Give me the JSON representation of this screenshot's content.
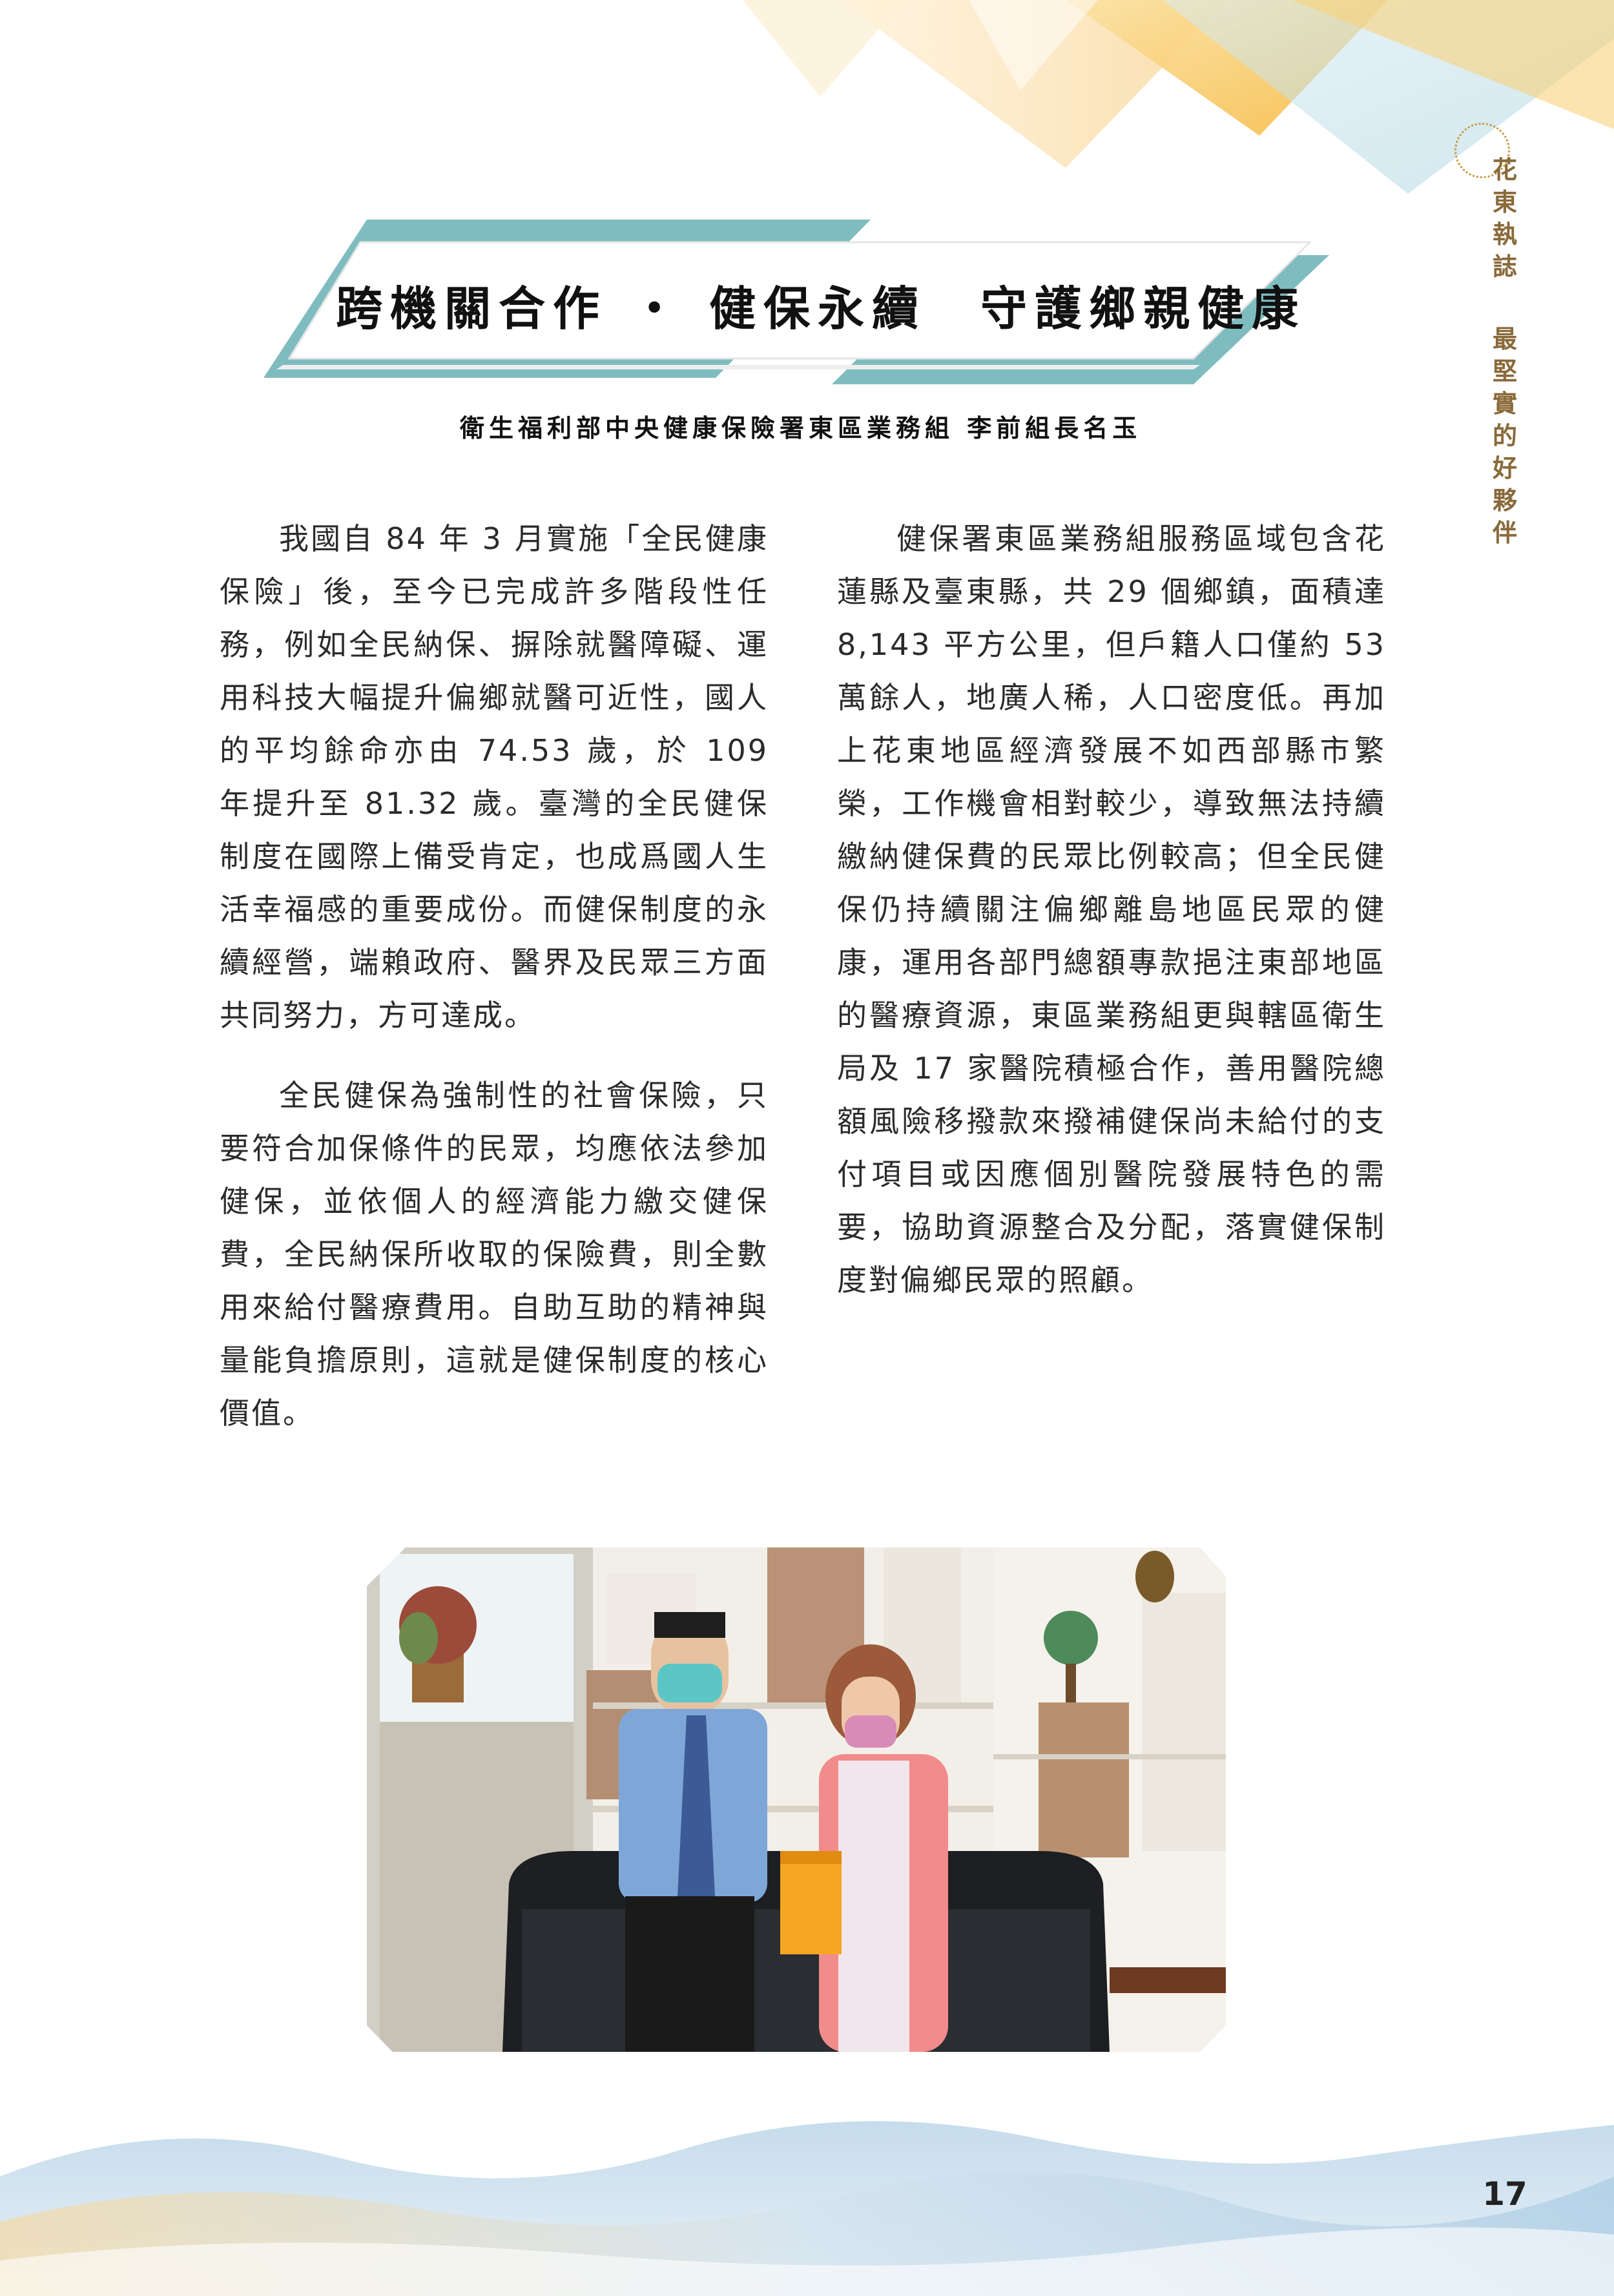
{
  "side_tag": {
    "part_a": [
      "花",
      "東",
      "執",
      "誌"
    ],
    "part_b": [
      "最",
      "堅",
      "實",
      "的",
      "好",
      "夥",
      "伴"
    ]
  },
  "title": "跨機關合作 ‧ 健保永續　守護鄉親健康",
  "byline": "衛生福利部中央健康保險署東區業務組 李前組長名玉",
  "left_column": [
    "我國自 84 年 3 月實施「全民健康保險」後，至今已完成許多階段性任務，例如全民納保、摒除就醫障礙、運用科技大幅提升偏鄉就醫可近性，國人的平均餘命亦由 74.53 歲，於 109 年提升至 81.32 歲。臺灣的全民健保制度在國際上備受肯定，也成爲國人生活幸福感的重要成份。而健保制度的永續經營，端賴政府、醫界及民眾三方面共同努力，方可達成。",
    "全民健保為強制性的社會保險，只要符合加保條件的民眾，均應依法參加健保，並依個人的經濟能力繳交健保費，全民納保所收取的保險費，則全數用來給付醫療費用。自助互助的精神與量能負擔原則，這就是健保制度的核心價值。"
  ],
  "right_column": [
    "健保署東區業務組服務區域包含花蓮縣及臺東縣，共 29 個鄉鎮，面積達 8,143 平方公里，但戶籍人口僅約 53 萬餘人，地廣人稀，人口密度低。再加上花東地區經濟發展不如西部縣市繁榮，工作機會相對較少，導致無法持續繳納健保費的民眾比例較高；但全民健保仍持續關注偏鄉離島地區民眾的健康，運用各部門總額專款挹注東部地區的醫療資源，東區業務組更與轄區衛生局及 17 家醫院積極合作，善用醫院總額風險移撥款來撥補健保尚未給付的支付項目或因應個別醫院發展特色的需要，協助資源整合及分配，落實健保制度對偏鄉民眾的照顧。"
  ],
  "page_number": "17",
  "colors": {
    "banner_teal": "#7fbcc0",
    "header_gold": "#f5c86a",
    "wave_blue": "#a9cbe3"
  }
}
